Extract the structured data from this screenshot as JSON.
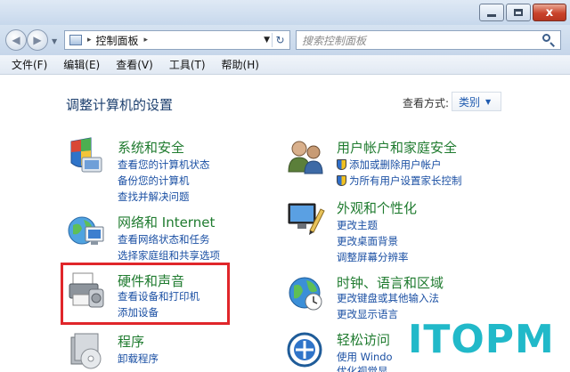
{
  "window": {
    "close_glyph": "x"
  },
  "address_bar": {
    "breadcrumb": "控制面板",
    "separator": "▸",
    "search_placeholder": "搜索控制面板"
  },
  "menu": [
    "文件(F)",
    "编辑(E)",
    "查看(V)",
    "工具(T)",
    "帮助(H)"
  ],
  "content": {
    "title": "调整计算机的设置",
    "view_by_label": "查看方式:",
    "view_by_value": "类别"
  },
  "categories": [
    {
      "title": "系统和安全",
      "links": [
        "查看您的计算机状态",
        "备份您的计算机",
        "查找并解决问题"
      ]
    },
    {
      "title": "网络和 Internet",
      "links": [
        "查看网络状态和任务",
        "选择家庭组和共享选项"
      ]
    },
    {
      "title": "硬件和声音",
      "links": [
        "查看设备和打印机",
        "添加设备"
      ]
    },
    {
      "title": "程序",
      "links": [
        "卸载程序"
      ]
    },
    {
      "title": "用户帐户和家庭安全",
      "links": [
        "添加或删除用户帐户",
        "为所有用户设置家长控制"
      ]
    },
    {
      "title": "外观和个性化",
      "links": [
        "更改主题",
        "更改桌面背景",
        "调整屏幕分辨率"
      ]
    },
    {
      "title": "时钟、语言和区域",
      "links": [
        "更改键盘或其他输入法",
        "更改显示语言"
      ]
    },
    {
      "title": "轻松访问",
      "links": [
        "使用 Windo",
        "优化视觉显"
      ]
    }
  ],
  "watermark": "ITOPM",
  "colors": {
    "category_title": "#1f7b2f",
    "link": "#1a4fa3",
    "highlight": "#e0262a",
    "watermark": "#21b9c9"
  }
}
